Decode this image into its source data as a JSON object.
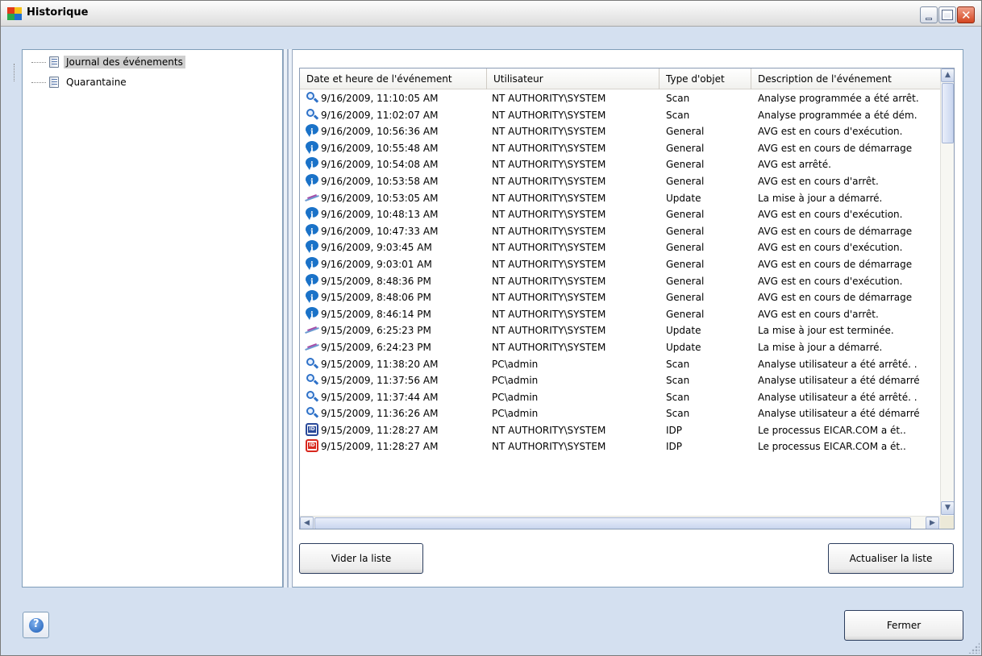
{
  "window": {
    "title": "Historique"
  },
  "tree": {
    "items": [
      {
        "label": "Journal des événements",
        "selected": true
      },
      {
        "label": "Quarantaine",
        "selected": false
      }
    ]
  },
  "table": {
    "columns": [
      "Date et heure de l'événement",
      "Utilisateur",
      "Type d'objet",
      "Description de l'événement"
    ],
    "rows": [
      {
        "icon": "scan-icon",
        "date": "9/16/2009, 11:10:05 AM",
        "user": "NT AUTHORITY\\SYSTEM",
        "type": "Scan",
        "desc": "Analyse programmée a été arrêt."
      },
      {
        "icon": "scan-icon",
        "date": "9/16/2009, 11:02:07 AM",
        "user": "NT AUTHORITY\\SYSTEM",
        "type": "Scan",
        "desc": "Analyse programmée a été dém."
      },
      {
        "icon": "info-icon",
        "date": "9/16/2009, 10:56:36 AM",
        "user": "NT AUTHORITY\\SYSTEM",
        "type": "General",
        "desc": "AVG est en cours d'exécution."
      },
      {
        "icon": "info-icon",
        "date": "9/16/2009, 10:55:48 AM",
        "user": "NT AUTHORITY\\SYSTEM",
        "type": "General",
        "desc": "AVG est en cours de démarrage"
      },
      {
        "icon": "info-icon",
        "date": "9/16/2009, 10:54:08 AM",
        "user": "NT AUTHORITY\\SYSTEM",
        "type": "General",
        "desc": "AVG est arrêté."
      },
      {
        "icon": "info-icon",
        "date": "9/16/2009, 10:53:58 AM",
        "user": "NT AUTHORITY\\SYSTEM",
        "type": "General",
        "desc": "AVG est en cours d'arrêt."
      },
      {
        "icon": "update-icon",
        "date": "9/16/2009, 10:53:05 AM",
        "user": "NT AUTHORITY\\SYSTEM",
        "type": "Update",
        "desc": "La mise à jour a démarré."
      },
      {
        "icon": "info-icon",
        "date": "9/16/2009, 10:48:13 AM",
        "user": "NT AUTHORITY\\SYSTEM",
        "type": "General",
        "desc": "AVG est en cours d'exécution."
      },
      {
        "icon": "info-icon",
        "date": "9/16/2009, 10:47:33 AM",
        "user": "NT AUTHORITY\\SYSTEM",
        "type": "General",
        "desc": "AVG est en cours de démarrage"
      },
      {
        "icon": "info-icon",
        "date": "9/16/2009, 9:03:45 AM",
        "user": "NT AUTHORITY\\SYSTEM",
        "type": "General",
        "desc": "AVG est en cours d'exécution."
      },
      {
        "icon": "info-icon",
        "date": "9/16/2009, 9:03:01 AM",
        "user": "NT AUTHORITY\\SYSTEM",
        "type": "General",
        "desc": "AVG est en cours de démarrage"
      },
      {
        "icon": "info-icon",
        "date": "9/15/2009, 8:48:36 PM",
        "user": "NT AUTHORITY\\SYSTEM",
        "type": "General",
        "desc": "AVG est en cours d'exécution."
      },
      {
        "icon": "info-icon",
        "date": "9/15/2009, 8:48:06 PM",
        "user": "NT AUTHORITY\\SYSTEM",
        "type": "General",
        "desc": "AVG est en cours de démarrage"
      },
      {
        "icon": "info-icon",
        "date": "9/15/2009, 8:46:14 PM",
        "user": "NT AUTHORITY\\SYSTEM",
        "type": "General",
        "desc": "AVG est en cours d'arrêt."
      },
      {
        "icon": "update-icon",
        "date": "9/15/2009, 6:25:23 PM",
        "user": "NT AUTHORITY\\SYSTEM",
        "type": "Update",
        "desc": "La mise à jour est terminée."
      },
      {
        "icon": "update-icon",
        "date": "9/15/2009, 6:24:23 PM",
        "user": "NT AUTHORITY\\SYSTEM",
        "type": "Update",
        "desc": "La mise à jour a démarré."
      },
      {
        "icon": "scan-icon",
        "date": "9/15/2009, 11:38:20 AM",
        "user": "PC\\admin",
        "type": "Scan",
        "desc": "Analyse utilisateur a été arrêté. ."
      },
      {
        "icon": "scan-icon",
        "date": "9/15/2009, 11:37:56 AM",
        "user": "PC\\admin",
        "type": "Scan",
        "desc": "Analyse utilisateur a été démarré"
      },
      {
        "icon": "scan-icon",
        "date": "9/15/2009, 11:37:44 AM",
        "user": "PC\\admin",
        "type": "Scan",
        "desc": "Analyse utilisateur a été arrêté. ."
      },
      {
        "icon": "scan-icon",
        "date": "9/15/2009, 11:36:26 AM",
        "user": "PC\\admin",
        "type": "Scan",
        "desc": "Analyse utilisateur a été démarré"
      },
      {
        "icon": "idp-icon",
        "date": "9/15/2009, 11:28:27 AM",
        "user": "NT AUTHORITY\\SYSTEM",
        "type": "IDP",
        "desc": "Le processus EICAR.COM a ét.."
      },
      {
        "icon": "idp-alert-icon",
        "date": "9/15/2009, 11:28:27 AM",
        "user": "NT AUTHORITY\\SYSTEM",
        "type": "IDP",
        "desc": "Le processus EICAR.COM a ét.."
      }
    ]
  },
  "buttons": {
    "clear": "Vider la liste",
    "refresh": "Actualiser la liste",
    "close": "Fermer"
  },
  "colors": {
    "scan": "#2f72c8",
    "info": "#1a72c8",
    "idp": "#2a4a9a",
    "idp_alert": "#d8281e",
    "close_button": "#d4451f"
  }
}
